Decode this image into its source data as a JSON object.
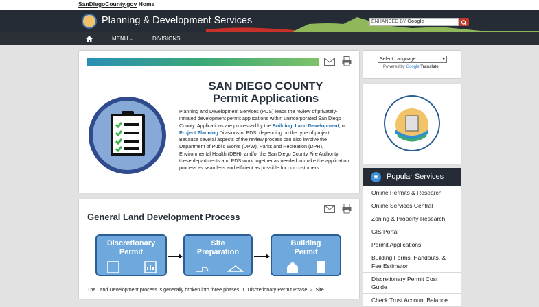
{
  "topbar": {
    "home_link": "SanDiegoCounty.gov",
    "home_suffix": " Home"
  },
  "header": {
    "title": "Planning & Development Services",
    "search_placeholder": "ENHANCED BY",
    "search_brand": "Google"
  },
  "nav": {
    "menu": "MENU",
    "divisions": "DIVISIONS"
  },
  "intro": {
    "title_line1": "SAN DIEGO COUNTY",
    "title_line2": "Permit Applications",
    "p1": "Planning and Development Services (PDS) leads the review of privately-initiated development permit applications within unincorporated San Diego County. Applications are processed by the ",
    "link1": "Building",
    "sep1": ", ",
    "link2": "Land Development",
    "sep2": ", or ",
    "link3": "Project Planning",
    "p2": " Divisions of PDS, depending on the type of project. Because several aspects of the review process can also involve the Department of Public Works (DPW), Parks and Recreation (DPR), Environmental Health (DEH), and/or the San Diego County Fire Authority, these departments and PDS work together as needed to make the application process as seamless and efficient as possible for our customers."
  },
  "process": {
    "title": "General Land Development Process",
    "steps": [
      "Discretionary Permit",
      "Site Preparation",
      "Building Permit"
    ],
    "caption": "The Land Development process is generally broken into three phases: 1. Discretionary Permit Phase, 2. Site"
  },
  "sidebar": {
    "language_select": "Select Language",
    "powered_by": "Powered by",
    "google": "Google",
    "translate": "Translate",
    "popular_title": "Popular Services",
    "items": [
      "Online Permits & Research",
      "Online Services Central",
      "Zoning & Property Research",
      "GIS Portal",
      "Permit Applications",
      "Building Forms, Handouts, & Fee Estimator",
      "Discretionary Permit Cost Guide",
      "Check Trust Account Balance"
    ]
  },
  "colors": {
    "header_bg": "#262c35",
    "link": "#1a6aa8",
    "flow_box": "#6fa8dc"
  }
}
